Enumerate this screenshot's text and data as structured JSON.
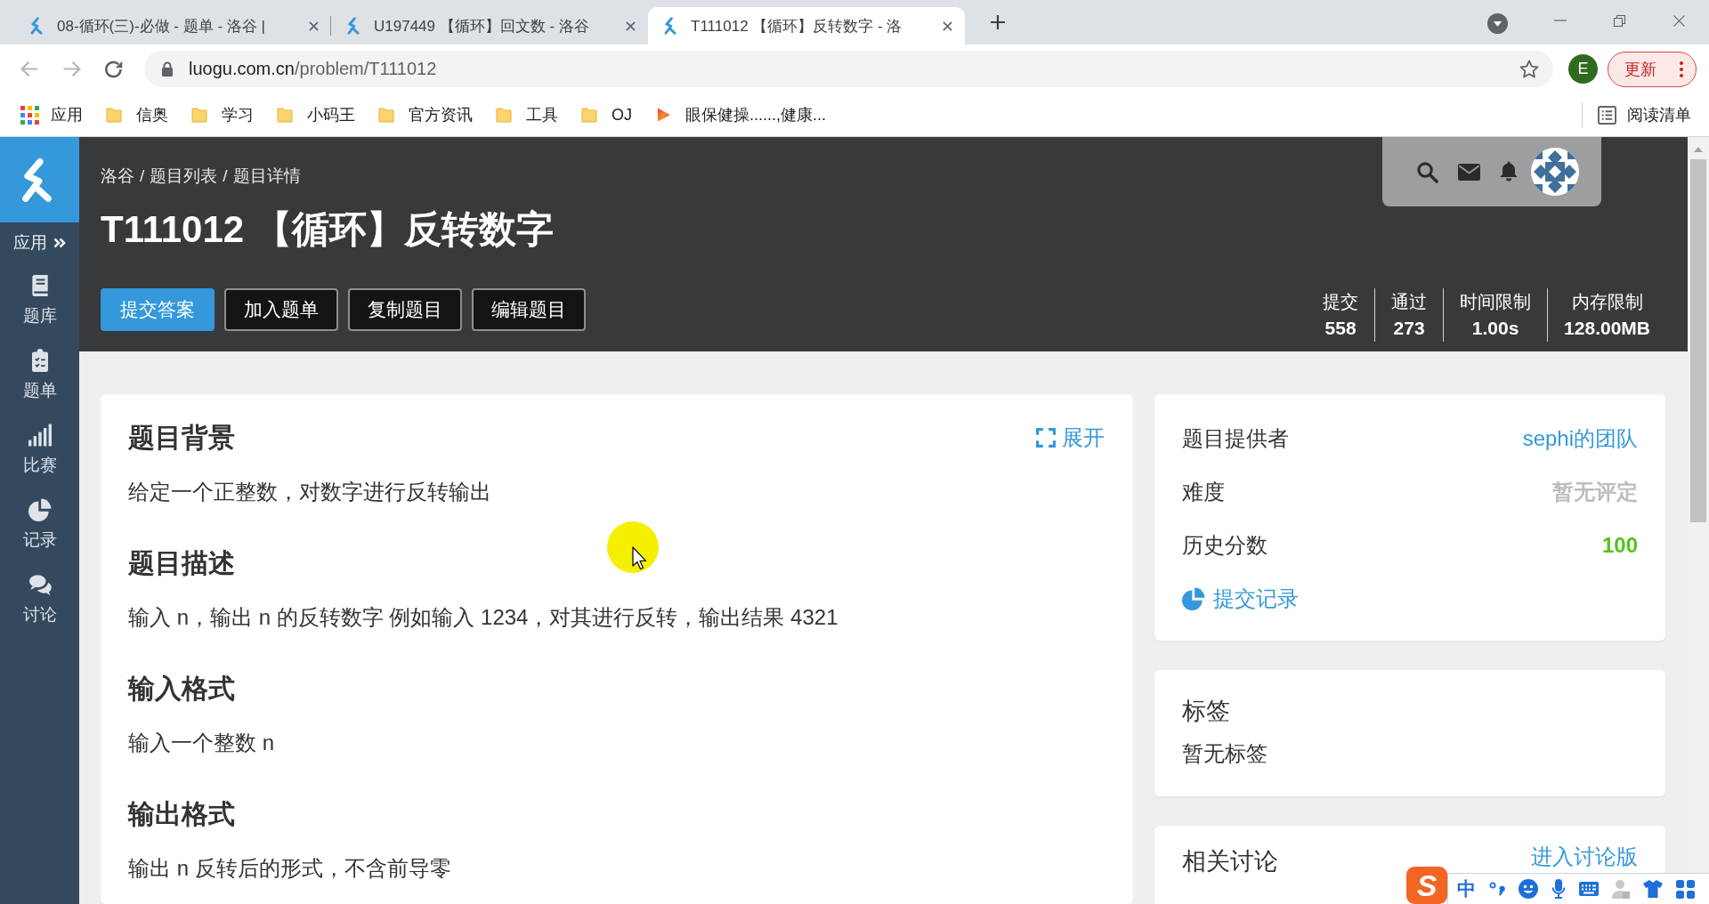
{
  "browser": {
    "tabs": [
      {
        "title": "08-循环(三)-必做 - 题单 - 洛谷 |",
        "selected": false
      },
      {
        "title": "U197449 【循环】回文数 - 洛谷",
        "selected": false
      },
      {
        "title": "T111012 【循环】反转数字 - 洛",
        "selected": true
      }
    ],
    "url": {
      "host": "luogu.com.cn",
      "path": "/problem/T111012"
    },
    "profile_initial": "E",
    "update_button": "更新",
    "bookmarks": [
      {
        "label": "应用",
        "kind": "apps"
      },
      {
        "label": "信奥",
        "kind": "folder"
      },
      {
        "label": "学习",
        "kind": "folder"
      },
      {
        "label": "小码王",
        "kind": "folder"
      },
      {
        "label": "官方资讯",
        "kind": "folder"
      },
      {
        "label": "工具",
        "kind": "folder"
      },
      {
        "label": "OJ",
        "kind": "folder"
      },
      {
        "label": "眼保健操......,健康...",
        "kind": "site"
      }
    ],
    "reading_list": "阅读清单"
  },
  "sidebar": {
    "apps_menu": "应用",
    "items": [
      "题库",
      "题单",
      "比赛",
      "记录",
      "讨论"
    ]
  },
  "header": {
    "breadcrumb": {
      "items": [
        "洛谷",
        "题目列表",
        "题目详情"
      ],
      "separator": "/"
    },
    "title": "T111012 【循环】反转数字",
    "buttons": [
      {
        "label": "提交答案",
        "kind": "primary"
      },
      {
        "label": "加入题单",
        "kind": "outline"
      },
      {
        "label": "复制题目",
        "kind": "outline"
      },
      {
        "label": "编辑题目",
        "kind": "outline"
      }
    ],
    "stats": [
      {
        "label": "提交",
        "value": "558"
      },
      {
        "label": "通过",
        "value": "273"
      },
      {
        "label": "时间限制",
        "value": "1.00s"
      },
      {
        "label": "内存限制",
        "value": "128.00MB"
      }
    ]
  },
  "problem": {
    "expand_link": "展开",
    "sections": [
      {
        "heading": "题目背景",
        "text": "给定一个正整数，对数字进行反转输出"
      },
      {
        "heading": "题目描述",
        "text": "输入 n，输出 n 的反转数字 例如输入 1234，对其进行反转，输出结果 4321"
      },
      {
        "heading": "输入格式",
        "text": "输入一个整数 n"
      },
      {
        "heading": "输出格式",
        "text": "输出 n 反转后的形式，不含前导零"
      }
    ]
  },
  "info": {
    "rows": [
      {
        "label": "题目提供者",
        "value": "sephi的团队",
        "kind": "link"
      },
      {
        "label": "难度",
        "value": "暂无评定",
        "kind": "muted"
      },
      {
        "label": "历史分数",
        "value": "100",
        "kind": "score"
      }
    ],
    "records_link": "提交记录"
  },
  "tags": {
    "title": "标签",
    "empty_text": "暂无标签"
  },
  "discussion": {
    "title": "相关讨论",
    "link": "进入讨论版"
  },
  "ime_toolbar": {
    "logo": "S",
    "mode": "中"
  }
}
